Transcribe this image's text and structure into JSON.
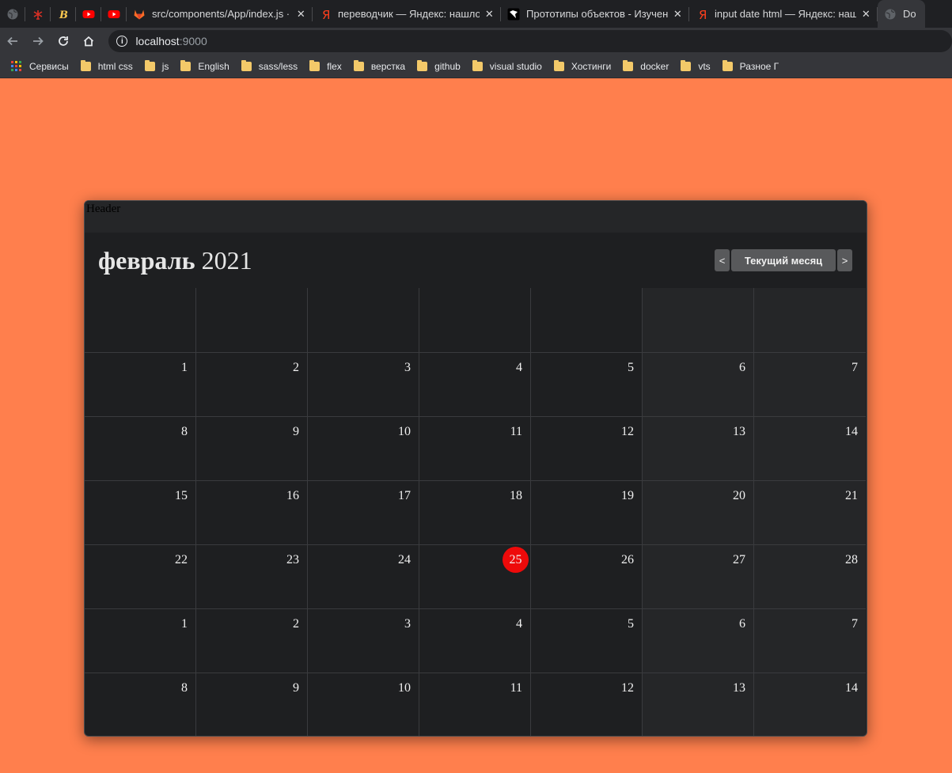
{
  "browser": {
    "tabs": [
      {
        "type": "pinned",
        "icon": "globe-icon"
      },
      {
        "type": "pinned",
        "icon": "windmill-icon"
      },
      {
        "type": "pinned",
        "icon": "b-logo-icon"
      },
      {
        "type": "pinned",
        "icon": "youtube-icon"
      },
      {
        "type": "pinned",
        "icon": "youtube-icon"
      },
      {
        "type": "normal",
        "icon": "gitlab-icon",
        "title": "src/components/App/index.js · d",
        "width": 235
      },
      {
        "type": "normal",
        "icon": "yandex-icon",
        "title": "переводчик — Яндекс: нашлос",
        "width": 238
      },
      {
        "type": "normal",
        "icon": "learnjs-icon",
        "title": "Прототипы объектов - Изучени",
        "width": 238
      },
      {
        "type": "normal",
        "icon": "yandex-icon",
        "title": "input date html — Яндекс: нашл",
        "width": 238
      },
      {
        "type": "active",
        "icon": "globe-icon",
        "title": "Do",
        "width": 60
      }
    ],
    "url_host": "localhost",
    "url_port": ":9000",
    "bookmarks": {
      "apps_label": "Сервисы",
      "items": [
        "html css",
        "js",
        "English",
        "sass/less",
        "flex",
        "верстка",
        "github",
        "visual studio",
        "Хостинги",
        "docker",
        "vts",
        "Разное Г"
      ]
    }
  },
  "calendar": {
    "header_text": "Header",
    "month": "февраль",
    "year": "2021",
    "prev_label": "<",
    "today_label": "Текущий месяц",
    "next_label": ">",
    "today_day": "25",
    "today_row": 3,
    "weeks": [
      [
        "1",
        "2",
        "3",
        "4",
        "5",
        "6",
        "7"
      ],
      [
        "8",
        "9",
        "10",
        "11",
        "12",
        "13",
        "14"
      ],
      [
        "15",
        "16",
        "17",
        "18",
        "19",
        "20",
        "21"
      ],
      [
        "22",
        "23",
        "24",
        "25",
        "26",
        "27",
        "28"
      ],
      [
        "1",
        "2",
        "3",
        "4",
        "5",
        "6",
        "7"
      ],
      [
        "8",
        "9",
        "10",
        "11",
        "12",
        "13",
        "14"
      ]
    ]
  },
  "colors": {
    "page_background": "#ff7f4d",
    "calendar_background": "#1e1f21",
    "today_marker": "#ee0a0a"
  }
}
